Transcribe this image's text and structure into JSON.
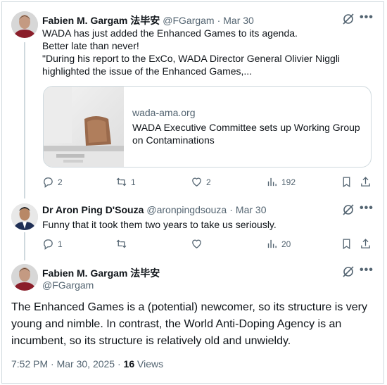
{
  "tweet1": {
    "name": "Fabien M. Gargam 法毕安",
    "handle": "@FGargam",
    "sep": "·",
    "date": "Mar 30",
    "lines": [
      "WADA has just added the Enhanced Games to its agenda.",
      "Better late than never!",
      "\"During his report to the ExCo, WADA Director General Olivier Niggli",
      "highlighted the issue of the Enhanced Games,..."
    ],
    "card": {
      "domain": "wada-ama.org",
      "title_line1": "WADA Executive Committee sets up Working Group",
      "title_line2": "on Contaminations"
    },
    "actions": {
      "replies": "2",
      "retweets": "1",
      "likes": "2",
      "views": "192"
    }
  },
  "tweet2": {
    "name": "Dr Aron Ping D'Souza",
    "handle": "@aronpingdsouza",
    "sep": "·",
    "date": "Mar 30",
    "text": "Funny that it took them two years to take us seriously.",
    "actions": {
      "replies": "1",
      "retweets": "",
      "likes": "",
      "views": "20"
    }
  },
  "tweet3": {
    "name": "Fabien M. Gargam 法毕安",
    "handle": "@FGargam",
    "lines": [
      "The Enhanced Games is a (potential) newcomer, so its structure is very",
      "young and nimble. In contrast, the World Anti-Doping Agency is an",
      "incumbent, so its structure is relatively old and unwieldy."
    ],
    "time": "7:52 PM",
    "sep": "·",
    "date": "Mar 30, 2025",
    "sep2": "·",
    "views": "16",
    "views_label": "Views"
  },
  "icons": {
    "more": "•••",
    "grok": "grok-icon",
    "reply": "reply-icon",
    "retweet": "retweet-icon",
    "like": "heart-icon",
    "views": "views-icon",
    "bookmark": "bookmark-icon",
    "share": "share-icon"
  },
  "colors": {
    "text": "#0f1419",
    "muted": "#536471",
    "border": "#cfd9de"
  }
}
